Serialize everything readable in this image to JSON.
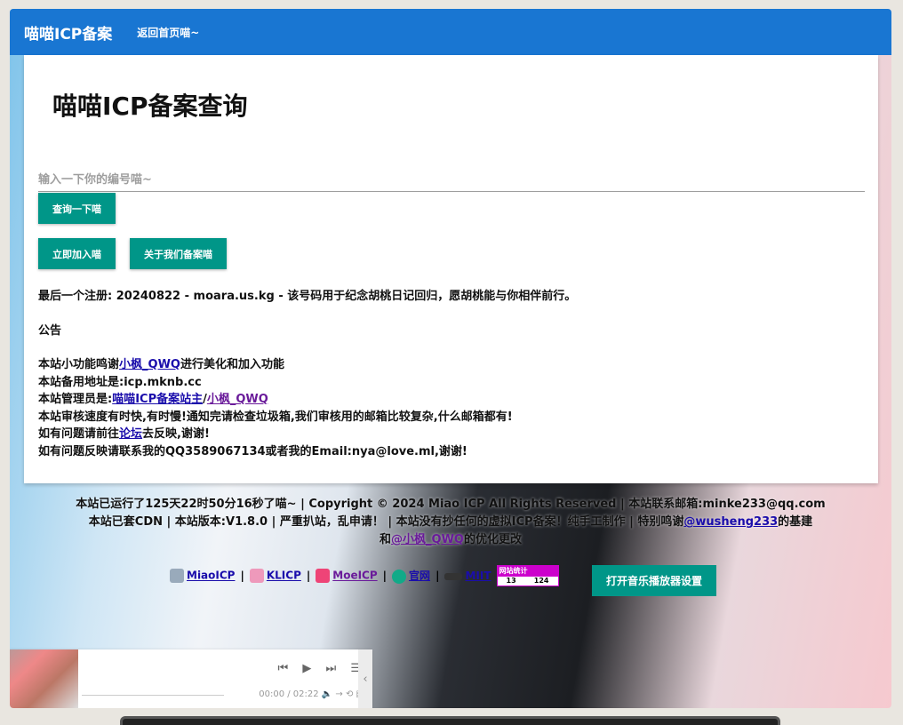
{
  "nav": {
    "brand": "喵喵ICP备案",
    "home": "返回首页喵~"
  },
  "main": {
    "title": "喵喵ICP备案查询",
    "search_placeholder": "输入一下你的编号喵~",
    "search_value": "",
    "query_button": "查询一下喵",
    "join_button": "立即加入喵",
    "about_button": "关于我们备案喵"
  },
  "latest": "最后一个注册: 20240822 - moara.us.kg - 该号码用于纪念胡桃日记回归，愿胡桃能与你相伴前行。",
  "notice": {
    "heading": "公告",
    "l1a": "本站小功能鸣谢",
    "l1link": "小枫_QWQ",
    "l1b": "进行美化和加入功能",
    "l2": "本站备用地址是:icp.mknb.cc",
    "l3a": "本站管理员是:",
    "l3link1": "喵喵ICP备案站主",
    "l3sep": "/",
    "l3link2": "小枫_QWQ",
    "l4": "本站审核速度有时快,有时慢!通知完请检查垃圾箱,我们审核用的邮箱比较复杂,什么邮箱都有!",
    "l5a": "如有问题请前往",
    "l5link": "论坛",
    "l5b": "去反映,谢谢!",
    "l6": "如有问题反映请联系我的QQ3589067134或者我的Email:nya@love.ml,谢谢!"
  },
  "footer": {
    "line1": "本站已运行了125天22时50分16秒了喵~ | Copyright © 2024 Miao ICP All Rights Reserved | 本站联系邮箱:minke233@qq.com",
    "line2a": "本站已套CDN | 本站版本:V1.8.0 | 严重扒站，乱申请！ | 本站没有抄任何的虚拟ICP备案！纯手工制作 | 特别鸣谢",
    "line2link": "@wusheng233",
    "line2b": "的基建",
    "line3a": "和",
    "line3link": "@小枫_QWQ",
    "line3b": "的优化更改"
  },
  "links": [
    {
      "label": "MiaoICP",
      "icon": "miaoicp-logo",
      "color": "#9ab"
    },
    {
      "label": "KLICP",
      "icon": "klicp-logo",
      "color": "#e9b"
    },
    {
      "label": "MoeICP",
      "icon": "moeicp-logo",
      "color": "#e47"
    },
    {
      "label": "官网",
      "icon": "official-logo",
      "color": "#1a8"
    },
    {
      "label": "MIIT",
      "icon": "miit-logo",
      "color": "#333"
    }
  ],
  "link_sep": "|",
  "stats": {
    "title": "网站统计",
    "today": "13",
    "total": "124"
  },
  "music_button": "打开音乐播放器设置",
  "player": {
    "time": "00:00 / 02:22",
    "controls": "⏮ ▶ ⏭ ☰",
    "extra": "🔈 → ⟲ ▤",
    "toggle": "‹"
  }
}
